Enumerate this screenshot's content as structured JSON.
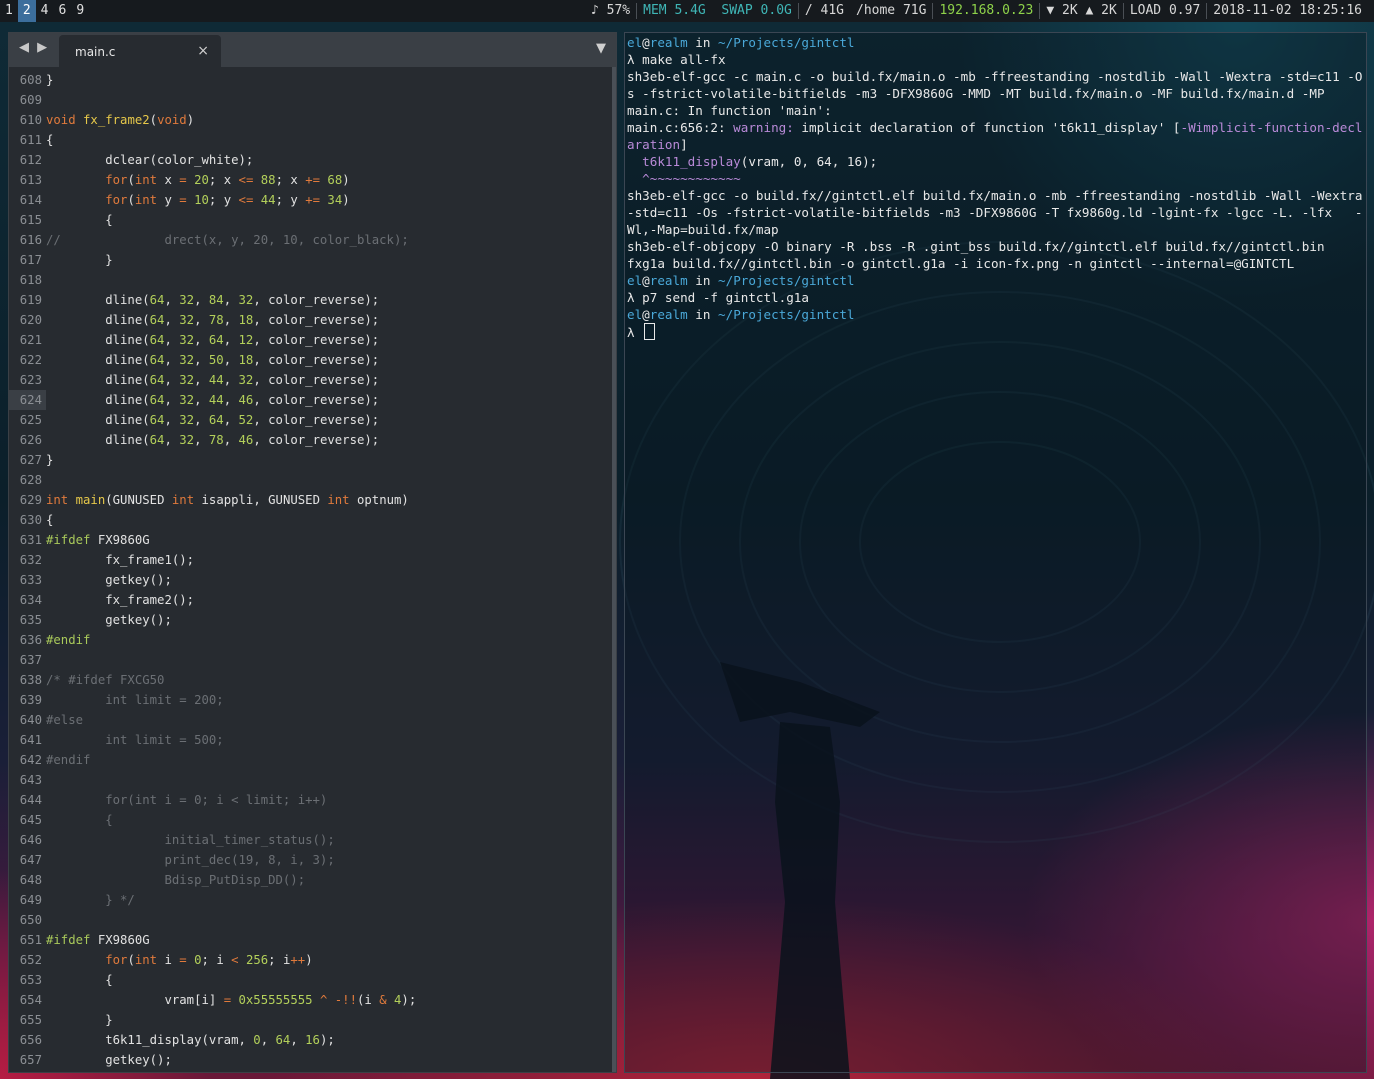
{
  "topbar": {
    "workspaces": [
      {
        "label": "1",
        "active": false
      },
      {
        "label": "2",
        "active": true
      },
      {
        "label": "4",
        "active": false
      },
      {
        "label": "6",
        "active": false
      },
      {
        "label": "9",
        "active": false
      }
    ],
    "volume": "♪ 57%",
    "mem_label": "MEM",
    "mem_value": "5.4G",
    "swap_label": "SWAP",
    "swap_value": "0.0G",
    "disk_root": "/ 41G",
    "disk_home": "/home 71G",
    "ip": "192.168.0.23",
    "net": "▼ 2K ▲ 2K",
    "load": "LOAD 0.97",
    "datetime": "2018-11-02 18:25:16"
  },
  "editor": {
    "nav_arrows": "◀ ▶",
    "tab_label": "main.c",
    "tab_close": "×",
    "tab_menu": "▼",
    "current_line": "624",
    "lines": [
      {
        "n": "608",
        "t": [
          [
            "",
            "}"
          ]
        ]
      },
      {
        "n": "609",
        "t": []
      },
      {
        "n": "610",
        "t": [
          [
            "kw",
            "void"
          ],
          [
            "",
            " "
          ],
          [
            "fn",
            "fx_frame2"
          ],
          [
            "",
            "("
          ],
          [
            "kw",
            "void"
          ],
          [
            "",
            ")"
          ]
        ]
      },
      {
        "n": "611",
        "t": [
          [
            "",
            "{"
          ]
        ]
      },
      {
        "n": "612",
        "t": [
          [
            "",
            "        dclear(color_white);"
          ]
        ]
      },
      {
        "n": "613",
        "t": [
          [
            "",
            "        "
          ],
          [
            "kw",
            "for"
          ],
          [
            "",
            "("
          ],
          [
            "ty",
            "int"
          ],
          [
            "",
            " x "
          ],
          [
            "op",
            "="
          ],
          [
            "",
            " "
          ],
          [
            "num",
            "20"
          ],
          [
            "",
            "; x "
          ],
          [
            "op",
            "<="
          ],
          [
            "",
            " "
          ],
          [
            "num",
            "88"
          ],
          [
            "",
            "; x "
          ],
          [
            "op",
            "+="
          ],
          [
            "",
            " "
          ],
          [
            "num",
            "68"
          ],
          [
            "",
            ")"
          ]
        ]
      },
      {
        "n": "614",
        "t": [
          [
            "",
            "        "
          ],
          [
            "kw",
            "for"
          ],
          [
            "",
            "("
          ],
          [
            "ty",
            "int"
          ],
          [
            "",
            " y "
          ],
          [
            "op",
            "="
          ],
          [
            "",
            " "
          ],
          [
            "num",
            "10"
          ],
          [
            "",
            "; y "
          ],
          [
            "op",
            "<="
          ],
          [
            "",
            " "
          ],
          [
            "num",
            "44"
          ],
          [
            "",
            "; y "
          ],
          [
            "op",
            "+="
          ],
          [
            "",
            " "
          ],
          [
            "num",
            "34"
          ],
          [
            "",
            ")"
          ]
        ]
      },
      {
        "n": "615",
        "t": [
          [
            "",
            "        {"
          ]
        ]
      },
      {
        "n": "616",
        "t": [
          [
            "cm",
            "//              drect(x, y, 20, 10, color_black);"
          ]
        ]
      },
      {
        "n": "617",
        "t": [
          [
            "",
            "        }"
          ]
        ]
      },
      {
        "n": "618",
        "t": []
      },
      {
        "n": "619",
        "t": [
          [
            "",
            "        dline("
          ],
          [
            "num",
            "64"
          ],
          [
            "",
            ", "
          ],
          [
            "num",
            "32"
          ],
          [
            "",
            ", "
          ],
          [
            "num",
            "84"
          ],
          [
            "",
            ", "
          ],
          [
            "num",
            "32"
          ],
          [
            "",
            ", color_reverse);"
          ]
        ]
      },
      {
        "n": "620",
        "t": [
          [
            "",
            "        dline("
          ],
          [
            "num",
            "64"
          ],
          [
            "",
            ", "
          ],
          [
            "num",
            "32"
          ],
          [
            "",
            ", "
          ],
          [
            "num",
            "78"
          ],
          [
            "",
            ", "
          ],
          [
            "num",
            "18"
          ],
          [
            "",
            ", color_reverse);"
          ]
        ]
      },
      {
        "n": "621",
        "t": [
          [
            "",
            "        dline("
          ],
          [
            "num",
            "64"
          ],
          [
            "",
            ", "
          ],
          [
            "num",
            "32"
          ],
          [
            "",
            ", "
          ],
          [
            "num",
            "64"
          ],
          [
            "",
            ", "
          ],
          [
            "num",
            "12"
          ],
          [
            "",
            ", color_reverse);"
          ]
        ]
      },
      {
        "n": "622",
        "t": [
          [
            "",
            "        dline("
          ],
          [
            "num",
            "64"
          ],
          [
            "",
            ", "
          ],
          [
            "num",
            "32"
          ],
          [
            "",
            ", "
          ],
          [
            "num",
            "50"
          ],
          [
            "",
            ", "
          ],
          [
            "num",
            "18"
          ],
          [
            "",
            ", color_reverse);"
          ]
        ]
      },
      {
        "n": "623",
        "t": [
          [
            "",
            "        dline("
          ],
          [
            "num",
            "64"
          ],
          [
            "",
            ", "
          ],
          [
            "num",
            "32"
          ],
          [
            "",
            ", "
          ],
          [
            "num",
            "44"
          ],
          [
            "",
            ", "
          ],
          [
            "num",
            "32"
          ],
          [
            "",
            ", color_reverse);"
          ]
        ]
      },
      {
        "n": "624",
        "t": [
          [
            "",
            "        dline("
          ],
          [
            "num",
            "64"
          ],
          [
            "",
            ", "
          ],
          [
            "num",
            "32"
          ],
          [
            "",
            ", "
          ],
          [
            "num",
            "44"
          ],
          [
            "",
            ", "
          ],
          [
            "num",
            "46"
          ],
          [
            "",
            ", color_reverse);"
          ]
        ]
      },
      {
        "n": "625",
        "t": [
          [
            "",
            "        dline("
          ],
          [
            "num",
            "64"
          ],
          [
            "",
            ", "
          ],
          [
            "num",
            "32"
          ],
          [
            "",
            ", "
          ],
          [
            "num",
            "64"
          ],
          [
            "",
            ", "
          ],
          [
            "num",
            "52"
          ],
          [
            "",
            ", color_reverse);"
          ]
        ]
      },
      {
        "n": "626",
        "t": [
          [
            "",
            "        dline("
          ],
          [
            "num",
            "64"
          ],
          [
            "",
            ", "
          ],
          [
            "num",
            "32"
          ],
          [
            "",
            ", "
          ],
          [
            "num",
            "78"
          ],
          [
            "",
            ", "
          ],
          [
            "num",
            "46"
          ],
          [
            "",
            ", color_reverse);"
          ]
        ]
      },
      {
        "n": "627",
        "t": [
          [
            "",
            "}"
          ]
        ]
      },
      {
        "n": "628",
        "t": []
      },
      {
        "n": "629",
        "t": [
          [
            "ty",
            "int"
          ],
          [
            "",
            " "
          ],
          [
            "fn",
            "main"
          ],
          [
            "",
            "(GUNUSED "
          ],
          [
            "ty",
            "int"
          ],
          [
            "",
            " isappli, GUNUSED "
          ],
          [
            "ty",
            "int"
          ],
          [
            "",
            " optnum)"
          ]
        ]
      },
      {
        "n": "630",
        "t": [
          [
            "",
            "{"
          ]
        ]
      },
      {
        "n": "631",
        "t": [
          [
            "pp",
            "#ifdef"
          ],
          [
            "",
            " FX9860G"
          ]
        ]
      },
      {
        "n": "632",
        "t": [
          [
            "",
            "        fx_frame1();"
          ]
        ]
      },
      {
        "n": "633",
        "t": [
          [
            "",
            "        getkey();"
          ]
        ]
      },
      {
        "n": "634",
        "t": [
          [
            "",
            "        fx_frame2();"
          ]
        ]
      },
      {
        "n": "635",
        "t": [
          [
            "",
            "        getkey();"
          ]
        ]
      },
      {
        "n": "636",
        "t": [
          [
            "pp",
            "#endif"
          ]
        ]
      },
      {
        "n": "637",
        "t": []
      },
      {
        "n": "638",
        "t": [
          [
            "cm",
            "/* #ifdef FXCG50"
          ]
        ]
      },
      {
        "n": "639",
        "t": [
          [
            "cm",
            "        int limit = 200;"
          ]
        ]
      },
      {
        "n": "640",
        "t": [
          [
            "cm",
            "#else"
          ]
        ]
      },
      {
        "n": "641",
        "t": [
          [
            "cm",
            "        int limit = 500;"
          ]
        ]
      },
      {
        "n": "642",
        "t": [
          [
            "cm",
            "#endif"
          ]
        ]
      },
      {
        "n": "643",
        "t": []
      },
      {
        "n": "644",
        "t": [
          [
            "cm",
            "        for(int i = 0; i < limit; i++)"
          ]
        ]
      },
      {
        "n": "645",
        "t": [
          [
            "cm",
            "        {"
          ]
        ]
      },
      {
        "n": "646",
        "t": [
          [
            "cm",
            "                initial_timer_status();"
          ]
        ]
      },
      {
        "n": "647",
        "t": [
          [
            "cm",
            "                print_dec(19, 8, i, 3);"
          ]
        ]
      },
      {
        "n": "648",
        "t": [
          [
            "cm",
            "                Bdisp_PutDisp_DD();"
          ]
        ]
      },
      {
        "n": "649",
        "t": [
          [
            "cm",
            "        } */"
          ]
        ]
      },
      {
        "n": "650",
        "t": []
      },
      {
        "n": "651",
        "t": [
          [
            "pp",
            "#ifdef"
          ],
          [
            "",
            " FX9860G"
          ]
        ]
      },
      {
        "n": "652",
        "t": [
          [
            "",
            "        "
          ],
          [
            "kw",
            "for"
          ],
          [
            "",
            "("
          ],
          [
            "ty",
            "int"
          ],
          [
            "",
            " i "
          ],
          [
            "op",
            "="
          ],
          [
            "",
            " "
          ],
          [
            "num",
            "0"
          ],
          [
            "",
            "; i "
          ],
          [
            "op",
            "<"
          ],
          [
            "",
            " "
          ],
          [
            "num",
            "256"
          ],
          [
            "",
            "; i"
          ],
          [
            "op",
            "++"
          ],
          [
            "",
            ")"
          ]
        ]
      },
      {
        "n": "653",
        "t": [
          [
            "",
            "        {"
          ]
        ]
      },
      {
        "n": "654",
        "t": [
          [
            "",
            "                vram[i] "
          ],
          [
            "op",
            "="
          ],
          [
            "",
            " "
          ],
          [
            "num",
            "0x55555555"
          ],
          [
            "",
            " "
          ],
          [
            "op",
            "^"
          ],
          [
            "",
            " "
          ],
          [
            "op",
            "-!!"
          ],
          [
            "",
            "(i "
          ],
          [
            "op",
            "&"
          ],
          [
            "",
            " "
          ],
          [
            "num",
            "4"
          ],
          [
            "",
            ");"
          ]
        ]
      },
      {
        "n": "655",
        "t": [
          [
            "",
            "        }"
          ]
        ]
      },
      {
        "n": "656",
        "t": [
          [
            "",
            "        t6k11_display(vram, "
          ],
          [
            "num",
            "0"
          ],
          [
            "",
            ", "
          ],
          [
            "num",
            "64"
          ],
          [
            "",
            ", "
          ],
          [
            "num",
            "16"
          ],
          [
            "",
            ");"
          ]
        ]
      },
      {
        "n": "657",
        "t": [
          [
            "",
            "        getkey();"
          ]
        ]
      }
    ]
  },
  "terminal": {
    "lines": [
      [
        [
          "user",
          "el"
        ],
        [
          "at",
          "@"
        ],
        [
          "user",
          "realm"
        ],
        [
          "",
          " in "
        ],
        [
          "path",
          "~/Projects/gintctl"
        ]
      ],
      [
        [
          "",
          "λ make all-fx"
        ]
      ],
      [
        [
          "",
          "sh3eb-elf-gcc -c main.c -o build.fx/main.o -mb -ffreestanding -nostdlib -Wall -Wextra -std=c11 -Os -fstrict-volatile-bitfields -m3 -DFX9860G -MMD -MT build.fx/main.o -MF build.fx/main.d -MP"
        ]
      ],
      [
        [
          "",
          "main.c: In function 'main':"
        ]
      ],
      [
        [
          "",
          "main.c:656:2: "
        ],
        [
          "warn",
          "warning: "
        ],
        [
          "",
          "implicit declaration of function 't6k11_display' ["
        ],
        [
          "purple",
          "-Wimplicit-function-declaration"
        ],
        [
          "",
          "]"
        ]
      ],
      [
        [
          "",
          "  "
        ],
        [
          "purple",
          "t6k11_display"
        ],
        [
          "",
          "(vram, 0, 64, 16);"
        ]
      ],
      [
        [
          "caret",
          "  ^~~~~~~~~~~~~"
        ]
      ],
      [
        [
          "",
          "sh3eb-elf-gcc -o build.fx//gintctl.elf build.fx/main.o -mb -ffreestanding -nostdlib -Wall -Wextra -std=c11 -Os -fstrict-volatile-bitfields -m3 -DFX9860G -T fx9860g.ld -lgint-fx -lgcc -L. -lfx   -Wl,-Map=build.fx/map"
        ]
      ],
      [
        [
          "",
          "sh3eb-elf-objcopy -O binary -R .bss -R .gint_bss build.fx//gintctl.elf build.fx//gintctl.bin"
        ]
      ],
      [
        [
          "",
          "fxg1a build.fx//gintctl.bin -o gintctl.g1a -i icon-fx.png -n gintctl --internal=@GINTCTL"
        ]
      ],
      [
        [
          "user",
          "el"
        ],
        [
          "at",
          "@"
        ],
        [
          "user",
          "realm"
        ],
        [
          "",
          " in "
        ],
        [
          "path",
          "~/Projects/gintctl"
        ]
      ],
      [
        [
          "",
          "λ p7 send -f gintctl.g1a"
        ]
      ],
      [
        [
          "user",
          "el"
        ],
        [
          "at",
          "@"
        ],
        [
          "user",
          "realm"
        ],
        [
          "",
          " in "
        ],
        [
          "path",
          "~/Projects/gintctl"
        ]
      ],
      [
        [
          "",
          "λ "
        ]
      ]
    ]
  }
}
